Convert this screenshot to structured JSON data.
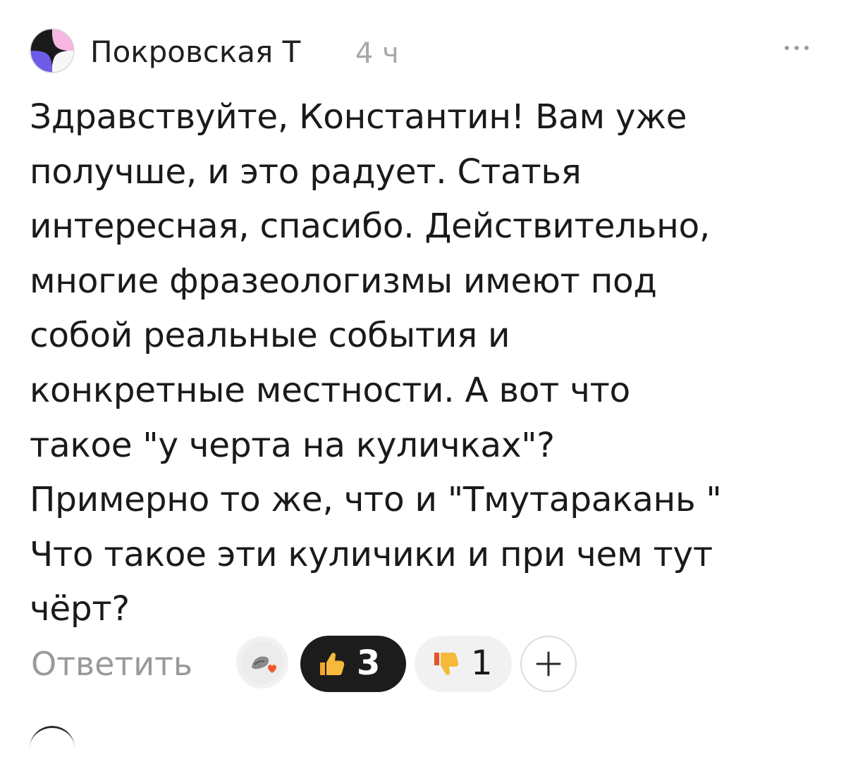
{
  "comment": {
    "author": "Покровская Т",
    "time": "4 ч",
    "text": "Здравствуйте, Константин! Вам уже\nполучше, и это радует. Статья\nинтересная, спасибо. Действительно,\nмногие фразеологизмы имеют под\nсобой реальные события и\nконкретные местности. А вот что\nтакое \"у черта на куличках\"?\nПримерно то же, что и \"Тмутаракань \"\nЧто такое эти куличики и при чем тут\nчёрт?",
    "reply_label": "Ответить",
    "reactions": {
      "like_count": "3",
      "dislike_count": "1"
    }
  },
  "icons": {
    "avatar": "star-avatar-icon",
    "more": "more-dots-icon",
    "like": "thumbs-up-icon",
    "dislike": "thumbs-down-icon",
    "add": "plus-icon",
    "reactor": "reactor-avatar-heart-icon"
  },
  "colors": {
    "text": "#1a1a1a",
    "muted": "#a8a8a8",
    "like_pill": "#1c1c1c",
    "dislike_pill": "#f1f1f1",
    "heart": "#f05a2a",
    "avatar_purple": "#6c5ce7",
    "avatar_pink": "#f6b6e0"
  }
}
